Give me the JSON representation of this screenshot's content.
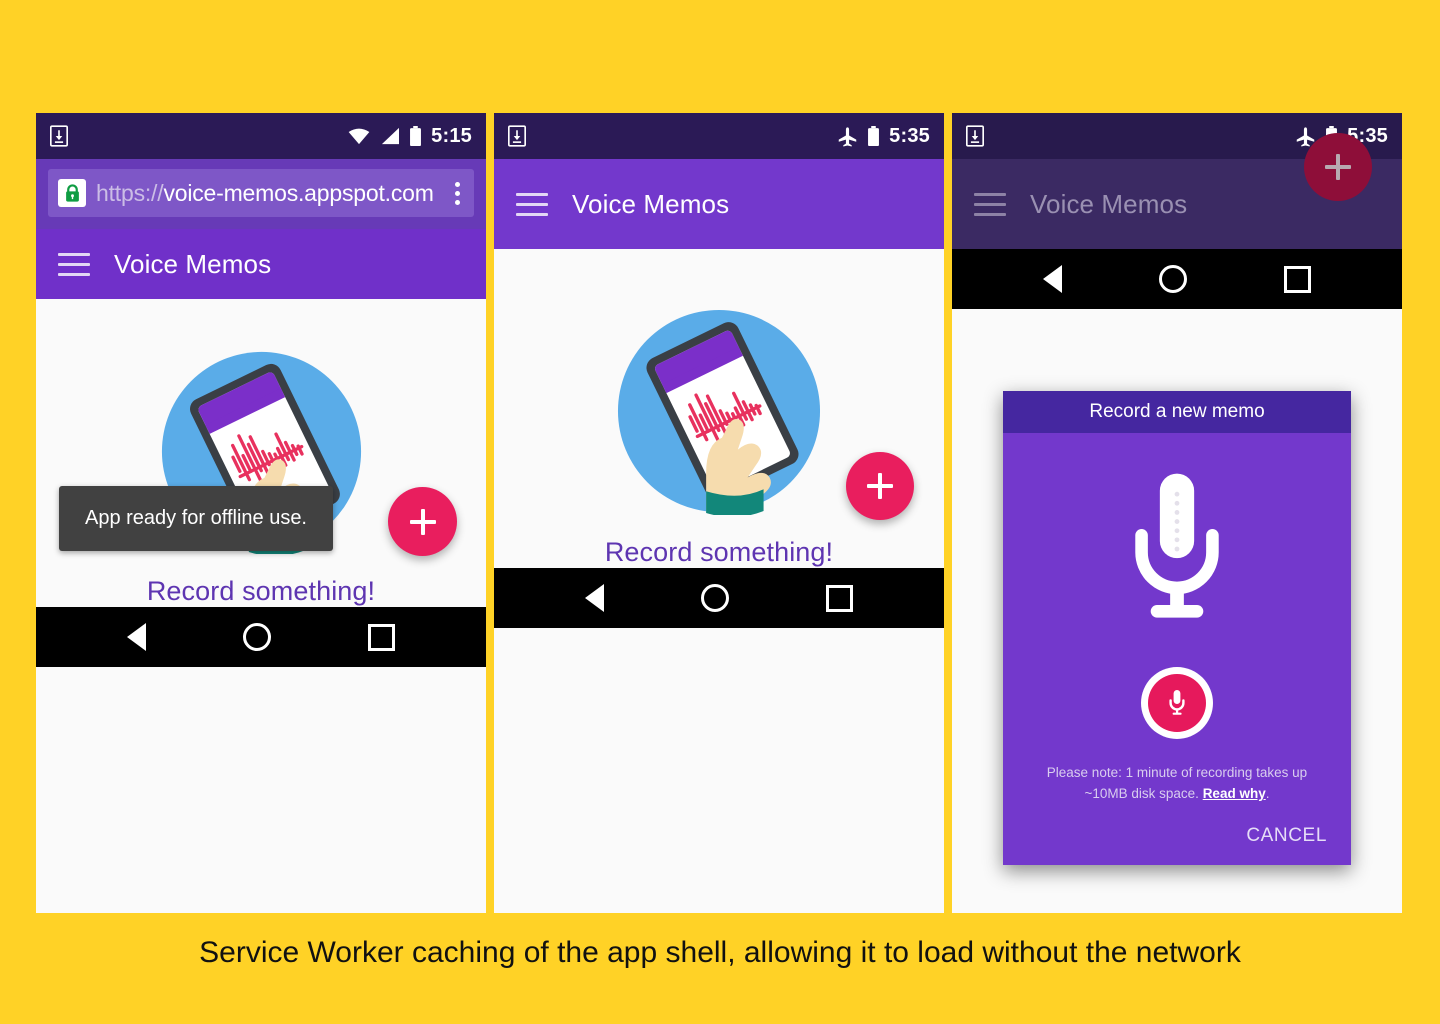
{
  "page": {
    "background_color": "#FFD226",
    "caption": "Service Worker caching of the app shell, allowing it to load without the network"
  },
  "colors": {
    "accent_pink": "#e91e5e",
    "app_purple": "#7030c9",
    "dialog_purple": "#7338cc",
    "dialog_title_purple": "#4527a0",
    "status_bar": "#2b1a56",
    "empty_text_purple": "#5e35b1",
    "scrim_gray": "#767676",
    "illustration_blue": "#5aace8",
    "illustration_sleeve": "#12877a",
    "illustration_skin": "#f6dcae",
    "waveform_red": "#e8315e"
  },
  "panels": [
    {
      "id": "panel-browser",
      "status_bar": {
        "download_icon": "download-icon",
        "wifi_icon": "wifi-icon",
        "signal_icon": "signal-icon",
        "battery_icon": "battery-icon",
        "time": "5:15"
      },
      "browser": {
        "lock_icon": "lock-icon",
        "url_scheme": "https://",
        "url_host": "voice-memos.appspot.com",
        "menu_icon": "kebab-menu-icon"
      },
      "app_bar": {
        "menu_icon": "hamburger-icon",
        "title": "Voice Memos"
      },
      "empty_state": {
        "illustration": "hand-holding-phone-illustration",
        "text": "Record something!"
      },
      "toast": "App ready for offline use.",
      "fab": {
        "icon": "plus-icon",
        "label": "+"
      },
      "nav_bar": {
        "back_icon": "back-triangle-icon",
        "home_icon": "home-circle-icon",
        "recents_icon": "recents-square-icon"
      }
    },
    {
      "id": "panel-standalone",
      "status_bar": {
        "download_icon": "download-icon",
        "airplane_icon": "airplane-mode-icon",
        "battery_icon": "battery-icon",
        "time": "5:35"
      },
      "app_bar": {
        "menu_icon": "hamburger-icon",
        "title": "Voice Memos"
      },
      "empty_state": {
        "illustration": "hand-holding-phone-illustration",
        "text": "Record something!"
      },
      "fab": {
        "icon": "plus-icon",
        "label": "+"
      },
      "nav_bar": {
        "back_icon": "back-triangle-icon",
        "home_icon": "home-circle-icon",
        "recents_icon": "recents-square-icon"
      }
    },
    {
      "id": "panel-record-dialog",
      "status_bar": {
        "download_icon": "download-icon",
        "airplane_icon": "airplane-mode-icon",
        "battery_icon": "battery-icon",
        "time": "5:35"
      },
      "app_bar": {
        "menu_icon": "hamburger-icon",
        "title": "Voice Memos"
      },
      "dialog": {
        "title": "Record a new memo",
        "mic_icon": "microphone-icon",
        "record_button_icon": "microphone-record-icon",
        "note_line1": "Please note: 1 minute of recording takes up",
        "note_line2_prefix": "~10MB disk space. ",
        "note_link": "Read why",
        "note_line2_suffix": ".",
        "cancel_label": "CANCEL"
      },
      "fab": {
        "icon": "plus-icon",
        "label": "+"
      },
      "nav_bar": {
        "back_icon": "back-triangle-icon",
        "home_icon": "home-circle-icon",
        "recents_icon": "recents-square-icon"
      }
    }
  ]
}
